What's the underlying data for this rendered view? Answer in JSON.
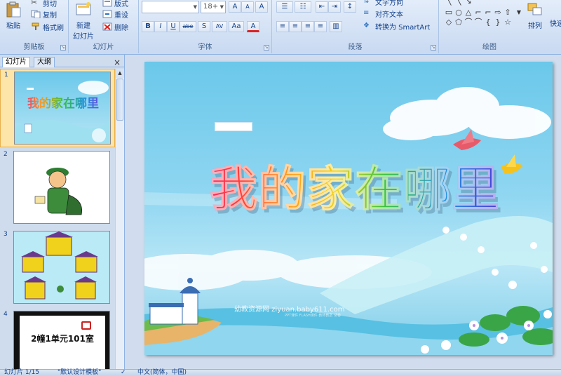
{
  "ribbon": {
    "clipboard": {
      "label": "剪贴板",
      "paste": "粘贴",
      "cut": "剪切",
      "copy": "复制",
      "format_painter": "格式刷"
    },
    "slides": {
      "label": "幻灯片",
      "new_slide_line1": "新建",
      "new_slide_line2": "幻灯片",
      "layout": "版式",
      "reset": "重设",
      "delete": "删除"
    },
    "font": {
      "label": "字体",
      "font_name": "",
      "font_size": "18+",
      "grow": "A",
      "shrink": "A",
      "clear": "A",
      "bold": "B",
      "italic": "I",
      "underline": "U",
      "strike": "abe",
      "shadow": "S",
      "spacing": "AV",
      "case": "Aa",
      "color": "A"
    },
    "paragraph": {
      "label": "段落",
      "text_direction": "文字方向",
      "align_text": "对齐文本",
      "smartart": "转换为 SmartArt"
    },
    "drawing": {
      "label": "绘图",
      "arrange": "排列",
      "quick_styles": "快速"
    }
  },
  "panel": {
    "tab_slides": "幻灯片",
    "tab_outline": "大纲",
    "close": "×",
    "thumbnails": [
      {
        "num": "1",
        "title": "我的家在哪里"
      },
      {
        "num": "2"
      },
      {
        "num": "3"
      },
      {
        "num": "4",
        "title": "2幢1单元101室"
      }
    ]
  },
  "slide": {
    "title": "我的家在哪里",
    "watermark": "幼教资源网 ziyuan.baby611.com",
    "watermark_sub": "PPT课件 FLASH课件 教师教案 试卷"
  },
  "status": {
    "slide_count": "幻灯片 1/15",
    "theme": "\"默认设计模板\"",
    "language": "中文(简体，中国)"
  }
}
